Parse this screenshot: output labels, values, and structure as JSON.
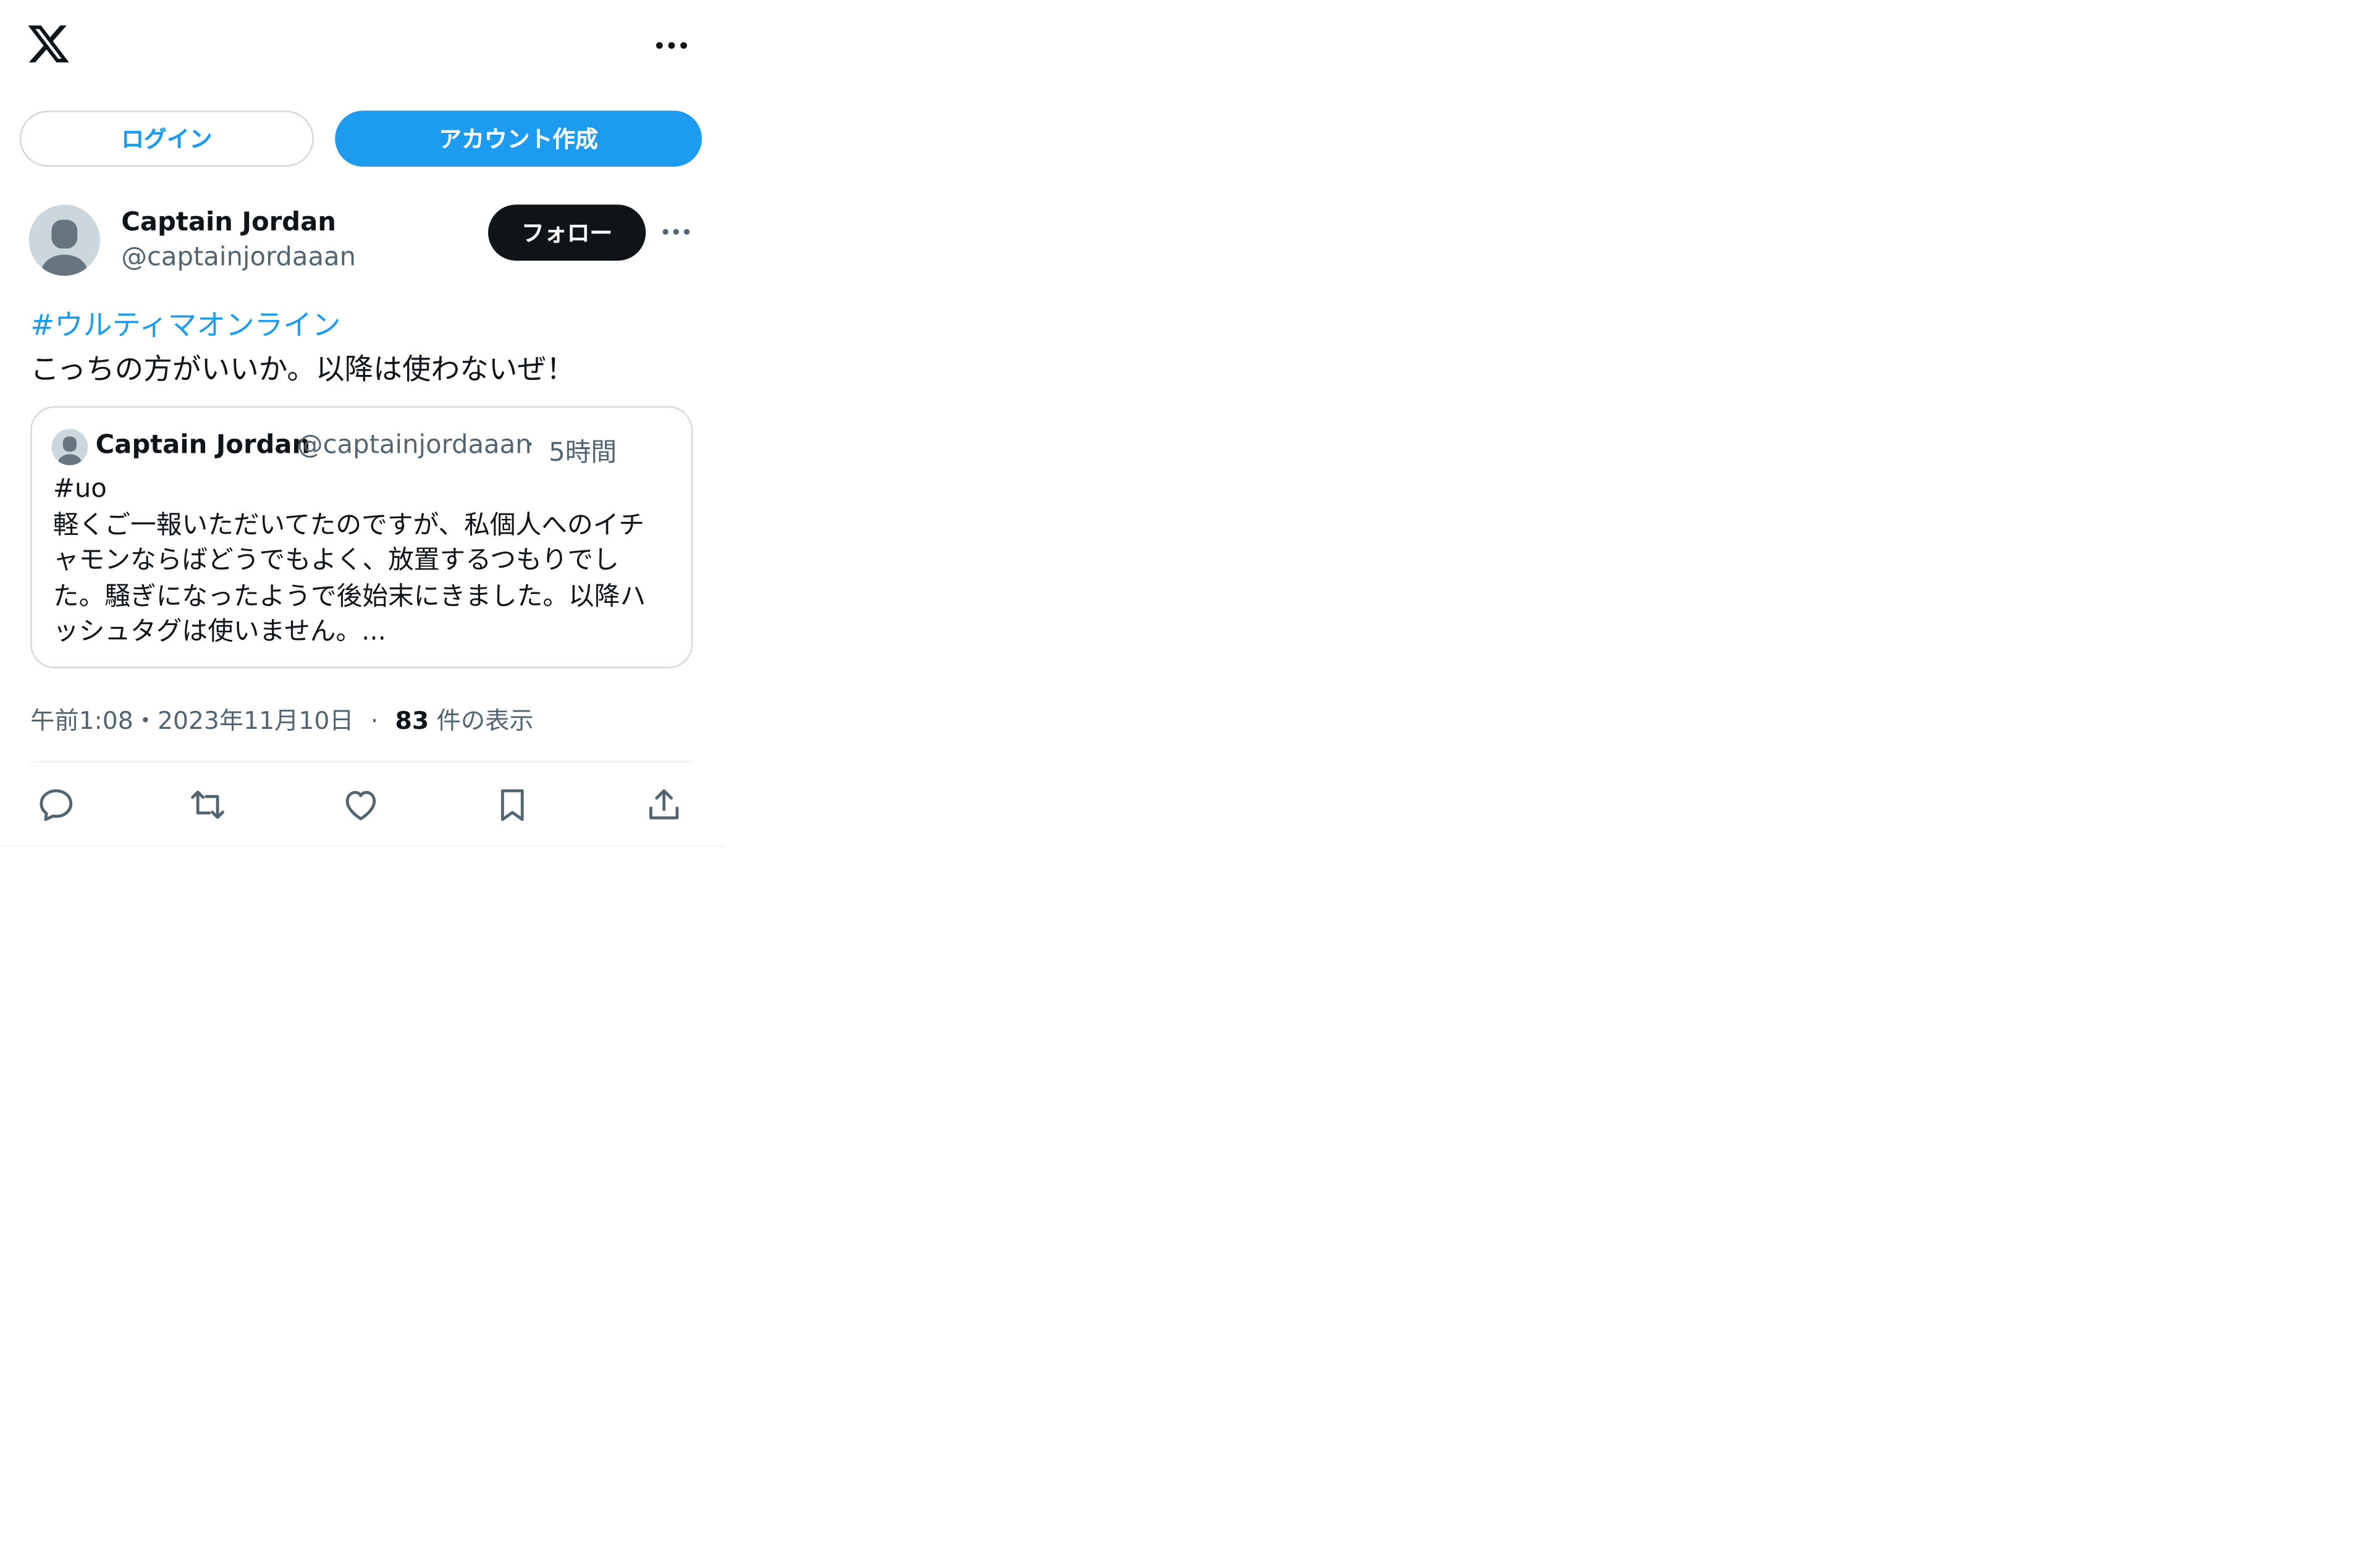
{
  "header": {
    "logo_icon": "x-logo-icon",
    "more_icon": "more-horizontal-icon"
  },
  "auth": {
    "login_label": "ログイン",
    "signup_label": "アカウント作成"
  },
  "tweet": {
    "author_name": "Captain Jordan",
    "author_handle": "@captainjordaaan",
    "follow_label": "フォロー",
    "hashtag": "#ウルティマオンライン",
    "text": "こっちの方がいいか。以降は使わないぜ！",
    "quoted": {
      "author_name": "Captain Jordan",
      "author_handle": "@captainjordaaan",
      "separator": "·",
      "time": "5時間",
      "text_lines": [
        "#uo",
        "軽くご一報いただいてたのですが、私個人へのイチ",
        "ャモンならばどうでもよく、放置するつもりでし",
        "た。騒ぎになったようで後始末にきました。以降ハ",
        "ッシュタグは使いません。..."
      ]
    },
    "timestamp": "午前1:08・2023年11月10日",
    "meta_separator": "·",
    "views_count": "83",
    "views_label": "件の表示"
  },
  "actions": [
    {
      "name": "reply-icon"
    },
    {
      "name": "retweet-icon"
    },
    {
      "name": "like-icon"
    },
    {
      "name": "bookmark-icon"
    },
    {
      "name": "share-icon"
    }
  ],
  "colors": {
    "accent": "#1d9bf0",
    "text": "#0f1419",
    "muted": "#536471",
    "border": "#cfd9de"
  }
}
